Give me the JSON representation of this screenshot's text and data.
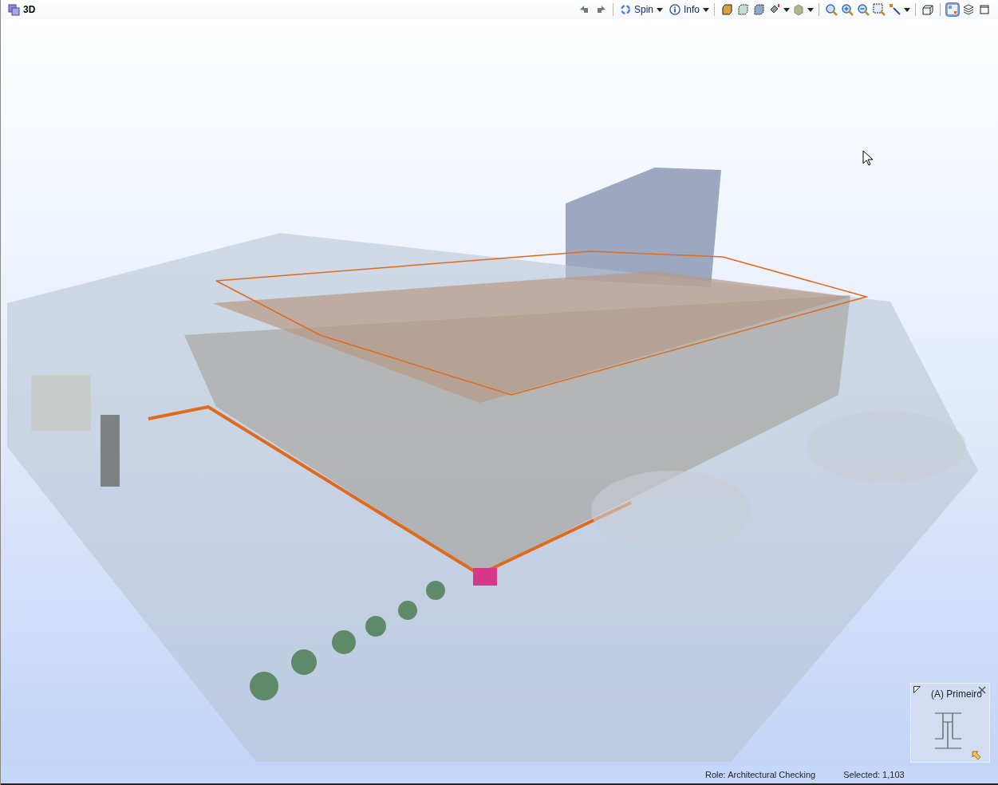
{
  "window": {
    "title": "3D"
  },
  "toolbar": {
    "spin": {
      "label": "Spin"
    },
    "info": {
      "label": "Info"
    }
  },
  "navigator_preview": {
    "title": "(A) Primeiro"
  },
  "status_bar": {
    "role": "Role: Architectural Checking",
    "selected": "Selected: 1,103"
  }
}
